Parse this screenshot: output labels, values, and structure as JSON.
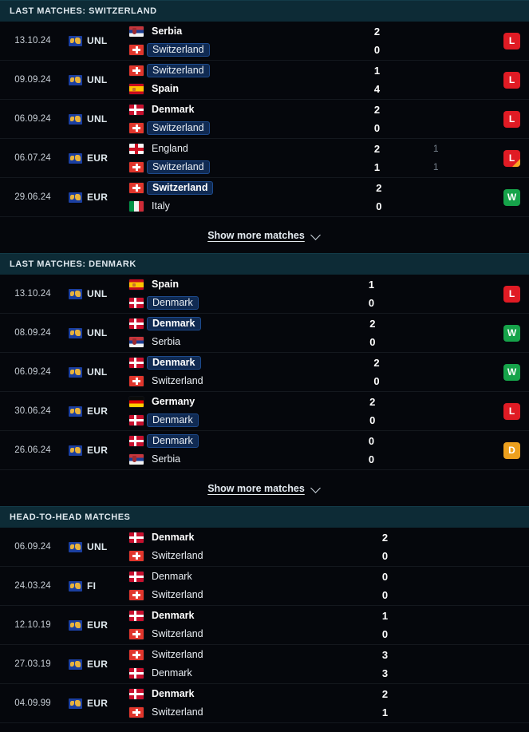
{
  "sections": [
    {
      "id": "last-matches-switzerland",
      "title": "LAST MATCHES: SWITZERLAND",
      "highlight_team": "Switzerland",
      "show_more_label": "Show more matches",
      "has_show_more": true,
      "has_result_badge": true,
      "matches": [
        {
          "date": "13.10.24",
          "competition": "UNL",
          "home": "Serbia",
          "away": "Switzerland",
          "home_score": "2",
          "away_score": "0",
          "home_pens": "",
          "away_pens": "",
          "home_bold": true,
          "away_bold": false,
          "result": "L",
          "result_pens": false
        },
        {
          "date": "09.09.24",
          "competition": "UNL",
          "home": "Switzerland",
          "away": "Spain",
          "home_score": "1",
          "away_score": "4",
          "home_pens": "",
          "away_pens": "",
          "home_bold": false,
          "away_bold": true,
          "result": "L",
          "result_pens": false
        },
        {
          "date": "06.09.24",
          "competition": "UNL",
          "home": "Denmark",
          "away": "Switzerland",
          "home_score": "2",
          "away_score": "0",
          "home_pens": "",
          "away_pens": "",
          "home_bold": true,
          "away_bold": false,
          "result": "L",
          "result_pens": false
        },
        {
          "date": "06.07.24",
          "competition": "EUR",
          "home": "England",
          "away": "Switzerland",
          "home_score": "2",
          "away_score": "1",
          "home_pens": "1",
          "away_pens": "1",
          "home_bold": false,
          "away_bold": false,
          "result": "L",
          "result_pens": true
        },
        {
          "date": "29.06.24",
          "competition": "EUR",
          "home": "Switzerland",
          "away": "Italy",
          "home_score": "2",
          "away_score": "0",
          "home_pens": "",
          "away_pens": "",
          "home_bold": true,
          "away_bold": false,
          "result": "W",
          "result_pens": false
        }
      ]
    },
    {
      "id": "last-matches-denmark",
      "title": "LAST MATCHES: DENMARK",
      "highlight_team": "Denmark",
      "show_more_label": "Show more matches",
      "has_show_more": true,
      "has_result_badge": true,
      "matches": [
        {
          "date": "13.10.24",
          "competition": "UNL",
          "home": "Spain",
          "away": "Denmark",
          "home_score": "1",
          "away_score": "0",
          "home_pens": "",
          "away_pens": "",
          "home_bold": true,
          "away_bold": false,
          "result": "L",
          "result_pens": false
        },
        {
          "date": "08.09.24",
          "competition": "UNL",
          "home": "Denmark",
          "away": "Serbia",
          "home_score": "2",
          "away_score": "0",
          "home_pens": "",
          "away_pens": "",
          "home_bold": true,
          "away_bold": false,
          "result": "W",
          "result_pens": false
        },
        {
          "date": "06.09.24",
          "competition": "UNL",
          "home": "Denmark",
          "away": "Switzerland",
          "home_score": "2",
          "away_score": "0",
          "home_pens": "",
          "away_pens": "",
          "home_bold": true,
          "away_bold": false,
          "result": "W",
          "result_pens": false
        },
        {
          "date": "30.06.24",
          "competition": "EUR",
          "home": "Germany",
          "away": "Denmark",
          "home_score": "2",
          "away_score": "0",
          "home_pens": "",
          "away_pens": "",
          "home_bold": true,
          "away_bold": false,
          "result": "L",
          "result_pens": false
        },
        {
          "date": "26.06.24",
          "competition": "EUR",
          "home": "Denmark",
          "away": "Serbia",
          "home_score": "0",
          "away_score": "0",
          "home_pens": "",
          "away_pens": "",
          "home_bold": false,
          "away_bold": false,
          "result": "D",
          "result_pens": false
        }
      ]
    },
    {
      "id": "head-to-head-matches",
      "title": "HEAD-TO-HEAD MATCHES",
      "highlight_team": "",
      "show_more_label": "",
      "has_show_more": false,
      "has_result_badge": false,
      "matches": [
        {
          "date": "06.09.24",
          "competition": "UNL",
          "home": "Denmark",
          "away": "Switzerland",
          "home_score": "2",
          "away_score": "0",
          "home_pens": "",
          "away_pens": "",
          "home_bold": true,
          "away_bold": false,
          "result": "",
          "result_pens": false
        },
        {
          "date": "24.03.24",
          "competition": "FI",
          "home": "Denmark",
          "away": "Switzerland",
          "home_score": "0",
          "away_score": "0",
          "home_pens": "",
          "away_pens": "",
          "home_bold": false,
          "away_bold": false,
          "result": "",
          "result_pens": false
        },
        {
          "date": "12.10.19",
          "competition": "EUR",
          "home": "Denmark",
          "away": "Switzerland",
          "home_score": "1",
          "away_score": "0",
          "home_pens": "",
          "away_pens": "",
          "home_bold": true,
          "away_bold": false,
          "result": "",
          "result_pens": false
        },
        {
          "date": "27.03.19",
          "competition": "EUR",
          "home": "Switzerland",
          "away": "Denmark",
          "home_score": "3",
          "away_score": "3",
          "home_pens": "",
          "away_pens": "",
          "home_bold": false,
          "away_bold": false,
          "result": "",
          "result_pens": false
        },
        {
          "date": "04.09.99",
          "competition": "EUR",
          "home": "Denmark",
          "away": "Switzerland",
          "home_score": "2",
          "away_score": "1",
          "home_pens": "",
          "away_pens": "",
          "home_bold": true,
          "away_bold": false,
          "result": "",
          "result_pens": false
        }
      ]
    }
  ],
  "colors": {
    "page_background": "#05070c",
    "section_header_background": "#0d2b36",
    "win": "#16a34a",
    "loss": "#e01b24",
    "draw": "#eda01e",
    "penalty_marker": "#f5a623",
    "highlight_pill": "#102a52"
  }
}
